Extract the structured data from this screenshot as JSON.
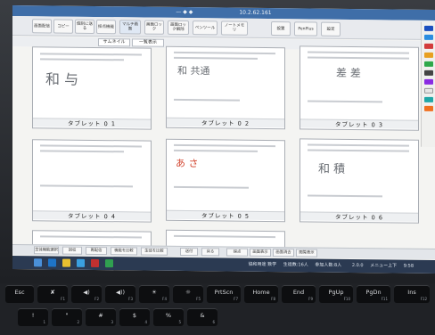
{
  "window": {
    "title": "10.2.62.161",
    "title_marker": "— ◆ ◆"
  },
  "toolbar": {
    "buttons": [
      "画面配信",
      "コピー",
      "個別に送る",
      "採点機能",
      "マルチ画面",
      "画面ロック",
      "画面ロック解除",
      "ペンツール",
      "ノートメモリ",
      "設置",
      "PenPlus",
      "設定"
    ]
  },
  "tabs": [
    "サムネイル",
    "一覧表示"
  ],
  "cells": [
    {
      "label": "タブレット 0 1",
      "hand": "和 与"
    },
    {
      "label": "タブレット 0 2",
      "hand": "和 共通"
    },
    {
      "label": "タブレット 0 3",
      "hand": "差 差"
    },
    {
      "label": "タブレット 0 4",
      "hand": ""
    },
    {
      "label": "タブレット 0 5",
      "hand": "あ さ"
    },
    {
      "label": "タブレット 0 6",
      "hand": "和 積"
    }
  ],
  "bottom_bar": {
    "buttons": [
      "生徒機能選択",
      "回収",
      "再配信",
      "機能を比較",
      "生徒を比較",
      "送付",
      "戻る",
      "採点",
      "画面表示",
      "画面消去",
      "閲覧表示"
    ]
  },
  "status": {
    "lesson": "協和用途 数学",
    "count_label": "生徒数:16人",
    "join_label": "参加人数:8人",
    "version": "2.0.0",
    "menu": "メニュー上下"
  },
  "taskbar": {
    "clock": "9:58"
  },
  "keyboard": {
    "row1": [
      {
        "main": "Esc",
        "sub": ""
      },
      {
        "main": "✘",
        "sub": "F1"
      },
      {
        "main": "◀)",
        "sub": "F2"
      },
      {
        "main": "◀))",
        "sub": "F3"
      },
      {
        "main": "☀",
        "sub": "F4"
      },
      {
        "main": "☼",
        "sub": "F5"
      },
      {
        "main": "PrtScn",
        "sub": "F7"
      },
      {
        "main": "Home",
        "sub": "F8"
      },
      {
        "main": "End",
        "sub": "F9"
      },
      {
        "main": "PgUp",
        "sub": "F10"
      },
      {
        "main": "PgDn",
        "sub": "F11"
      },
      {
        "main": "Ins",
        "sub": "F12"
      }
    ],
    "row2": [
      {
        "main": "!",
        "sub": "1"
      },
      {
        "main": "\"",
        "sub": "2"
      },
      {
        "main": "#",
        "sub": "3"
      },
      {
        "main": "$",
        "sub": "4"
      },
      {
        "main": "%",
        "sub": "5"
      },
      {
        "main": "&",
        "sub": "6"
      }
    ]
  },
  "colors": {
    "titlebar": "#3f6ea8",
    "taskbar": "#2b3a52",
    "pen_palette": [
      "#1b4fbf",
      "#2b8de0",
      "#d23b3b",
      "#e8a020",
      "#2ea84a",
      "#444444",
      "#8a2be2",
      "#e6e6e6",
      "#1fa7a7",
      "#f07020"
    ]
  }
}
